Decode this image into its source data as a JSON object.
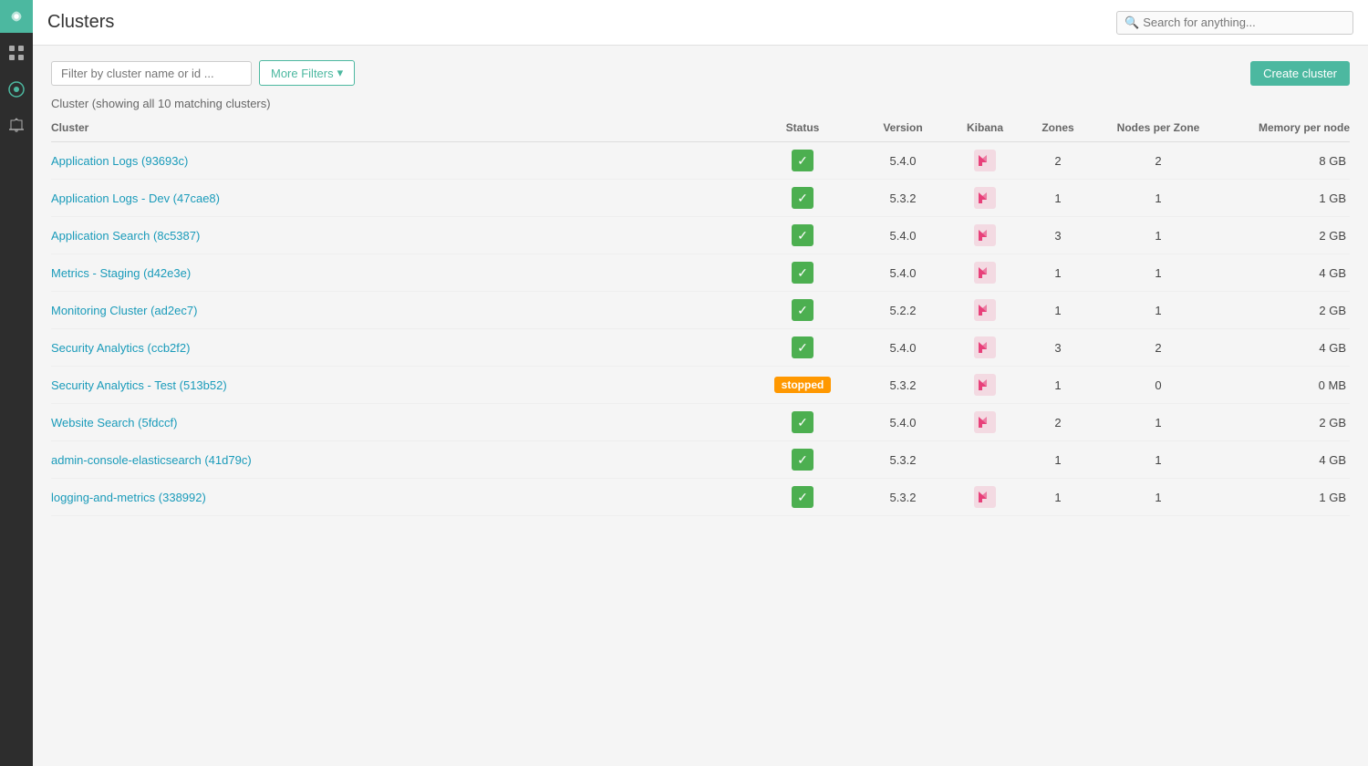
{
  "sidebar": {
    "logo_alt": "Logo",
    "items": [
      {
        "id": "apps",
        "icon": "apps-icon",
        "label": "Apps",
        "active": false
      },
      {
        "id": "activity",
        "icon": "activity-icon",
        "label": "Activity",
        "active": false
      },
      {
        "id": "notifications",
        "icon": "notifications-icon",
        "label": "Notifications",
        "active": false
      }
    ]
  },
  "header": {
    "title": "Clusters",
    "search_placeholder": "Search for anything..."
  },
  "filters": {
    "filter_placeholder": "Filter by cluster name or id ...",
    "more_filters_label": "More Filters",
    "create_cluster_label": "Create cluster"
  },
  "table": {
    "subtitle": "Cluster (showing all 10 matching clusters)",
    "columns": {
      "cluster": "Cluster",
      "status": "Status",
      "version": "Version",
      "kibana": "Kibana",
      "zones": "Zones",
      "nodes_per_zone": "Nodes per Zone",
      "memory_per_node": "Memory per node"
    },
    "rows": [
      {
        "name": "Application Logs (93693c)",
        "status": "ok",
        "version": "5.4.0",
        "kibana": true,
        "zones": 2,
        "nodes_per_zone": 2,
        "memory_per_node": "8 GB"
      },
      {
        "name": "Application Logs - Dev (47cae8)",
        "status": "ok",
        "version": "5.3.2",
        "kibana": true,
        "zones": 1,
        "nodes_per_zone": 1,
        "memory_per_node": "1 GB"
      },
      {
        "name": "Application Search (8c5387)",
        "status": "ok",
        "version": "5.4.0",
        "kibana": true,
        "zones": 3,
        "nodes_per_zone": 1,
        "memory_per_node": "2 GB"
      },
      {
        "name": "Metrics - Staging (d42e3e)",
        "status": "ok",
        "version": "5.4.0",
        "kibana": true,
        "zones": 1,
        "nodes_per_zone": 1,
        "memory_per_node": "4 GB"
      },
      {
        "name": "Monitoring Cluster (ad2ec7)",
        "status": "ok",
        "version": "5.2.2",
        "kibana": true,
        "zones": 1,
        "nodes_per_zone": 1,
        "memory_per_node": "2 GB"
      },
      {
        "name": "Security Analytics (ccb2f2)",
        "status": "ok",
        "version": "5.4.0",
        "kibana": true,
        "zones": 3,
        "nodes_per_zone": 2,
        "memory_per_node": "4 GB"
      },
      {
        "name": "Security Analytics - Test (513b52)",
        "status": "stopped",
        "version": "5.3.2",
        "kibana": true,
        "zones": 1,
        "nodes_per_zone": 0,
        "memory_per_node": "0 MB"
      },
      {
        "name": "Website Search (5fdccf)",
        "status": "ok",
        "version": "5.4.0",
        "kibana": true,
        "zones": 2,
        "nodes_per_zone": 1,
        "memory_per_node": "2 GB"
      },
      {
        "name": "admin-console-elasticsearch (41d79c)",
        "status": "ok",
        "version": "5.3.2",
        "kibana": false,
        "zones": 1,
        "nodes_per_zone": 1,
        "memory_per_node": "4 GB"
      },
      {
        "name": "logging-and-metrics (338992)",
        "status": "ok",
        "version": "5.3.2",
        "kibana": true,
        "zones": 1,
        "nodes_per_zone": 1,
        "memory_per_node": "1 GB"
      }
    ]
  }
}
